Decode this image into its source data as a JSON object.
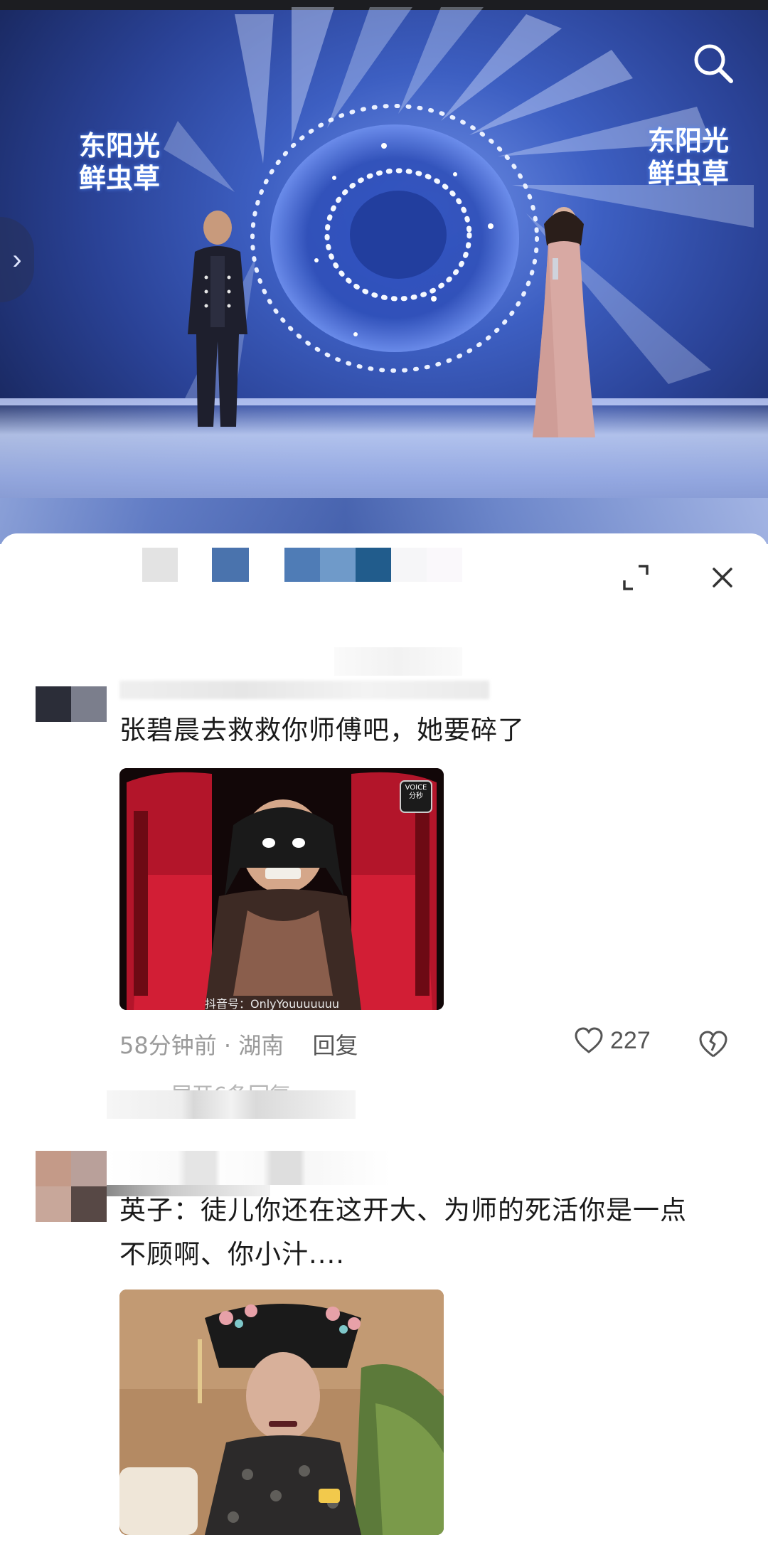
{
  "video": {
    "logo_left_line1": "东阳光",
    "logo_left_line2": "鲜虫草",
    "logo_right_line1": "东阳光",
    "logo_right_line2": "鲜虫草"
  },
  "comments": [
    {
      "text": "张碧晨去救救你师傅吧，她要碎了",
      "image_watermark": "抖音号：OnlyYouuuuuuu",
      "image_badge": "VOICE 分秒",
      "time": "58分钟前",
      "location": "湖南",
      "reply_label": "回复",
      "likes": "227",
      "expand_label": "展开6条回复"
    },
    {
      "text_line1": "英子：徒儿你还在这开大、为师的死活你是一点",
      "text_line2": "不顾啊、你小汁...."
    }
  ],
  "colors": {
    "stage_blue": "#3d5fc2",
    "sheet_bg": "#ffffff",
    "meta_gray": "#9a9a9a",
    "text_dark": "#1a1a1a"
  },
  "icons": [
    "search-icon",
    "chevron-right-icon",
    "expand-icon",
    "close-icon",
    "heart-icon",
    "broken-heart-icon"
  ]
}
